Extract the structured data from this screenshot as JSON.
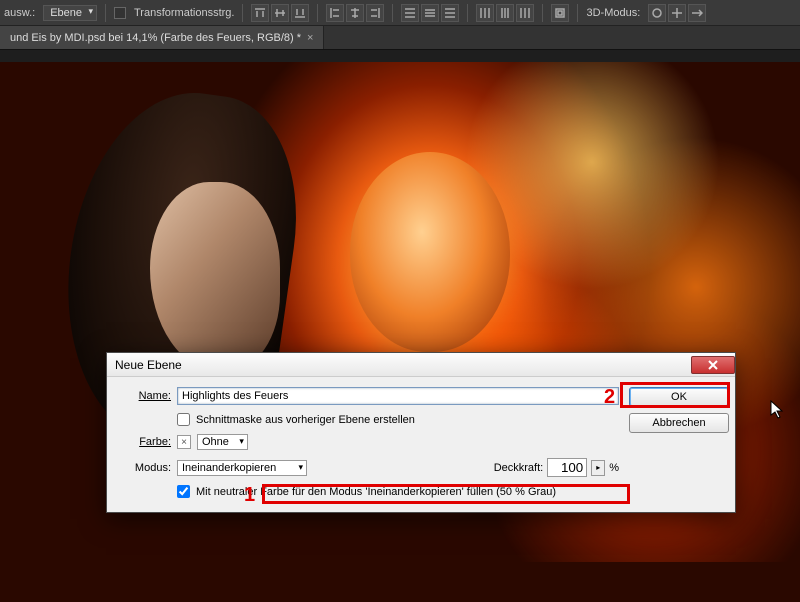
{
  "options_bar": {
    "ausw_label": "ausw.:",
    "ausw_value": "Ebene",
    "transform_checkbox_label": "Transformationsstrg.",
    "mode3d_label": "3D-Modus:"
  },
  "tab": {
    "title": "und Eis by MDI.psd bei 14,1% (Farbe des Feuers, RGB/8) *"
  },
  "dialog": {
    "title": "Neue Ebene",
    "name_label": "Name:",
    "name_value": "Highlights des Feuers",
    "clipmask_label": "Schnittmaske aus vorheriger Ebene erstellen",
    "color_label": "Farbe:",
    "color_swatch_symbol": "×",
    "color_value": "Ohne",
    "mode_label": "Modus:",
    "mode_value": "Ineinanderkopieren",
    "opacity_label": "Deckkraft:",
    "opacity_value": "100",
    "opacity_suffix": "%",
    "neutral_fill_label": "Mit neutraler Farbe für den Modus 'Ineinanderkopieren' füllen (50 % Grau)",
    "ok_label": "OK",
    "cancel_label": "Abbrechen"
  },
  "annotations": {
    "one": "1",
    "two": "2"
  }
}
